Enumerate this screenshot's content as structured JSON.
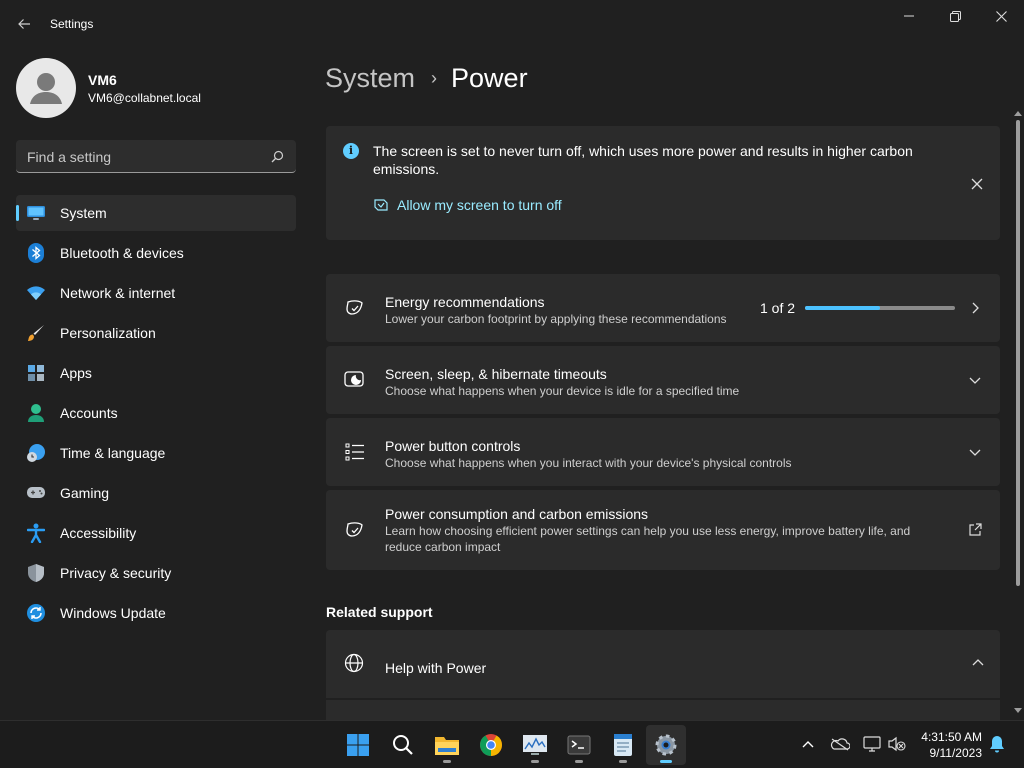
{
  "window": {
    "title": "Settings",
    "controls": [
      "minimize-icon",
      "restore-icon",
      "close-icon"
    ]
  },
  "user": {
    "name": "VM6",
    "email": "VM6@collabnet.local"
  },
  "search": {
    "placeholder": "Find a setting"
  },
  "sidebar": {
    "items": [
      {
        "label": "System",
        "icon": "monitor-icon",
        "active": true
      },
      {
        "label": "Bluetooth & devices",
        "icon": "bluetooth-icon"
      },
      {
        "label": "Network & internet",
        "icon": "wifi-icon"
      },
      {
        "label": "Personalization",
        "icon": "brush-icon"
      },
      {
        "label": "Apps",
        "icon": "apps-icon"
      },
      {
        "label": "Accounts",
        "icon": "person-icon"
      },
      {
        "label": "Time & language",
        "icon": "globe-clock-icon"
      },
      {
        "label": "Gaming",
        "icon": "gamepad-icon"
      },
      {
        "label": "Accessibility",
        "icon": "accessibility-icon"
      },
      {
        "label": "Privacy & security",
        "icon": "shield-icon"
      },
      {
        "label": "Windows Update",
        "icon": "update-icon"
      }
    ]
  },
  "breadcrumb": {
    "parent": "System",
    "current": "Power"
  },
  "infobar": {
    "message": "The screen is set to never turn off, which uses more power and results in higher carbon emissions.",
    "link": "Allow my screen to turn off"
  },
  "cards": [
    {
      "title": "Energy recommendations",
      "subtitle": "Lower your carbon footprint by applying these recommendations",
      "icon": "leaf-heart-icon",
      "progress_text": "1 of 2",
      "progress_fraction": 0.5,
      "right_icon": "chevron-right-icon"
    },
    {
      "title": "Screen, sleep, & hibernate timeouts",
      "subtitle": "Choose what happens when your device is idle for a specified time",
      "icon": "screen-sleep-icon",
      "right_icon": "chevron-down-icon"
    },
    {
      "title": "Power button controls",
      "subtitle": "Choose what happens when you interact with your device's physical controls",
      "icon": "list-icon",
      "right_icon": "chevron-down-icon"
    },
    {
      "title": "Power consumption and carbon emissions",
      "subtitle": "Learn how choosing efficient power settings can help you use less energy, improve battery life, and reduce carbon impact",
      "icon": "leaf-heart-icon",
      "right_icon": "external-link-icon"
    }
  ],
  "related_support": {
    "heading": "Related support",
    "items": [
      {
        "title": "Help with Power",
        "icon": "globe-icon",
        "right_icon": "chevron-up-icon"
      }
    ]
  },
  "taskbar": {
    "apps": [
      "start-icon",
      "search-icon",
      "file-explorer-icon",
      "chrome-icon",
      "resource-monitor-icon",
      "terminal-icon",
      "notepad-icon",
      "settings-icon"
    ],
    "active_app": "settings-icon",
    "tray": [
      "chevron-up-icon",
      "onedrive-icon",
      "network-icon",
      "volume-muted-icon",
      "notification-bell-icon"
    ],
    "time": "4:31:50 AM",
    "date": "9/11/2023"
  },
  "colors": {
    "background": "#202020",
    "card": "#2b2b2b",
    "accent": "#60cdff",
    "link": "#99ebff",
    "progress": "#4cc2ff"
  }
}
